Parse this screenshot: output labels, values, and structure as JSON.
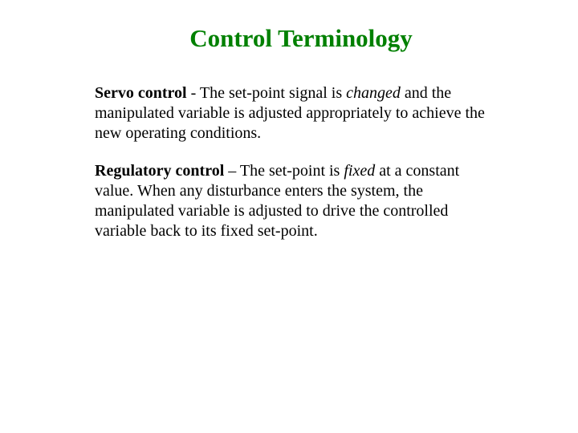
{
  "title": "Control Terminology",
  "paragraph1": {
    "term": "Servo control",
    "sep": " - The set-point signal is ",
    "emphasis": "changed",
    "rest": " and the manipulated variable is adjusted appropriately to achieve the new operating conditions."
  },
  "paragraph2": {
    "term": "Regulatory control",
    "sep": " – The set-point is ",
    "emphasis": "fixed",
    "rest": " at a constant value.  When any disturbance enters the system, the manipulated variable is adjusted to drive the controlled variable back to its fixed set-point."
  }
}
